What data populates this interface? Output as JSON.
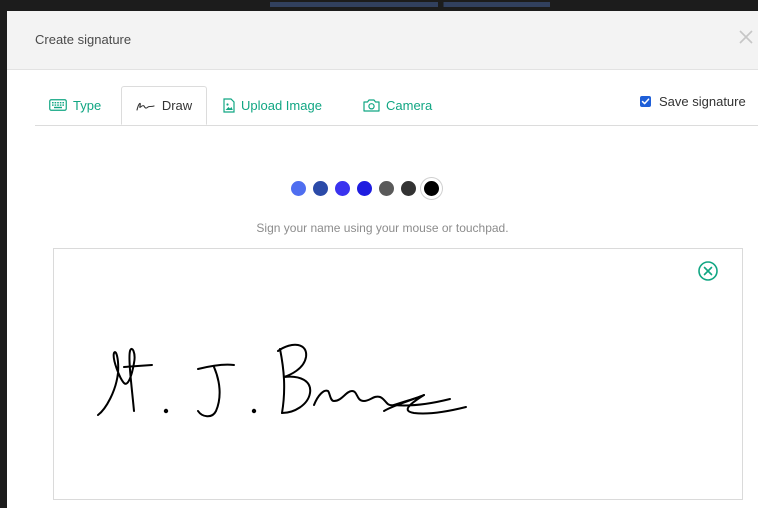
{
  "dialog": {
    "title": "Create signature",
    "close_icon": "close-icon"
  },
  "tabs": [
    {
      "label": "Type",
      "icon": "keyboard-icon",
      "active": false
    },
    {
      "label": "Draw",
      "icon": "signature-pen-icon",
      "active": true
    },
    {
      "label": "Upload Image",
      "icon": "image-file-icon",
      "active": false
    },
    {
      "label": "Camera",
      "icon": "camera-icon",
      "active": false
    }
  ],
  "save_signature": {
    "label": "Save signature",
    "checked": true
  },
  "pen_colors": [
    {
      "name": "light-blue",
      "hex": "#4f6ef0"
    },
    {
      "name": "navy",
      "hex": "#2b4aa8"
    },
    {
      "name": "royal-blue",
      "hex": "#3a33ef"
    },
    {
      "name": "blue",
      "hex": "#1f1de0"
    },
    {
      "name": "gray",
      "hex": "#5a5a5a"
    },
    {
      "name": "dark-gray",
      "hex": "#333333"
    },
    {
      "name": "black",
      "hex": "#000000",
      "selected": true
    }
  ],
  "draw_area": {
    "hint": "Sign your name using your mouse or touchpad.",
    "clear_icon": "clear-circle-x-icon",
    "ink_color": "#000000"
  },
  "theme": {
    "accent": "#11a683",
    "checkbox": "#1f5fd8"
  }
}
